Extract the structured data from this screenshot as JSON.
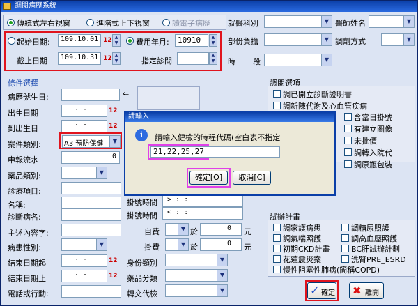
{
  "window": {
    "title": "調閱病歷系統"
  },
  "view": {
    "radio_side": "傳統式左右視窗",
    "radio_topdown": "進階式上下視窗",
    "radio_ecard": "讀電子病歷"
  },
  "dates": {
    "start_label": "起始日期:",
    "start_value": "109.10.01",
    "end_label": "截止日期",
    "end_value": "109.10.31",
    "fee_label": "費用年月:",
    "fee_value": "10910",
    "clinic_label": "指定診間",
    "mark": "12"
  },
  "top_right": {
    "dept_label": "就醫科別",
    "doctor_label": "醫師姓名",
    "share_label": "部份負擔",
    "dispense_label": "調劑方式",
    "time_label": "時",
    "seg_label": "段"
  },
  "conditions": {
    "title": "條件選擇",
    "birthday_label": "病歷號生日:",
    "dob_label": "出生日期",
    "dob_value": "· ·",
    "to_dob_label": "到出生日",
    "to_dob_value": "· ·",
    "case_label": "案件類別:",
    "case_value": "A3  預防保健",
    "report_label": "申報流水",
    "report_value": "0",
    "drug_label": "藥品類別:",
    "diag_item_label": "診療項目:",
    "name_label": "名稱:",
    "dx_label": "診斷病名:",
    "complaint_label": "主述內容字:",
    "gender_label": "病患性別:",
    "end_from_label": "結束日期起",
    "end_from_value": "· ·",
    "end_to_label": "結束日期止",
    "end_to_value": "· ·",
    "phone_label": "電話或行動:",
    "reg_time_label": "掛號時間",
    "reg_time_value": ">  :  :",
    "reg_time2_label": "掛號時間",
    "reg_time2_value": "<  :  :",
    "self_pay_label": "自費",
    "reg_fee_label": "掛費",
    "at_label": "於",
    "self_pay_value": "0",
    "reg_fee_value": "0",
    "yuan": "元",
    "id_type_label": "身份類別",
    "drug_class_label": "藥品分類",
    "transfer_label": "轉交代檢",
    "arrow": "⇐"
  },
  "options": {
    "title": "調閱選項",
    "items": [
      "調已開立診斷證明書",
      "調新陳代謝及心血管疾病",
      "含當日掛號",
      "有建立圖像",
      "未批價",
      "調轉入院代",
      "調原瓶包裝"
    ]
  },
  "trial": {
    "title": "試辦計畫",
    "left": [
      "調家護病患",
      "調氣喘照護",
      "初期CKD計畫",
      "花蓮震災案"
    ],
    "right": [
      "調糖尿照護",
      "調高血壓照護",
      "BC肝試辦計劃",
      "洗腎PRE_ESRD"
    ],
    "last": "慢性阻塞性肺病(簡稱COPD)"
  },
  "buttons": {
    "confirm": "確定",
    "leave": "離開"
  },
  "dialog": {
    "title": "請輸入",
    "prompt": "請輸入健檢的時程代碼(空白表不指定",
    "value": "21,22,25,27",
    "ok": "確定[O]",
    "cancel": "取消[C]"
  },
  "colors": {
    "accent_red": "#e0141e",
    "accent_pink": "#e040e8",
    "title_blue": "#0b3fa8"
  }
}
